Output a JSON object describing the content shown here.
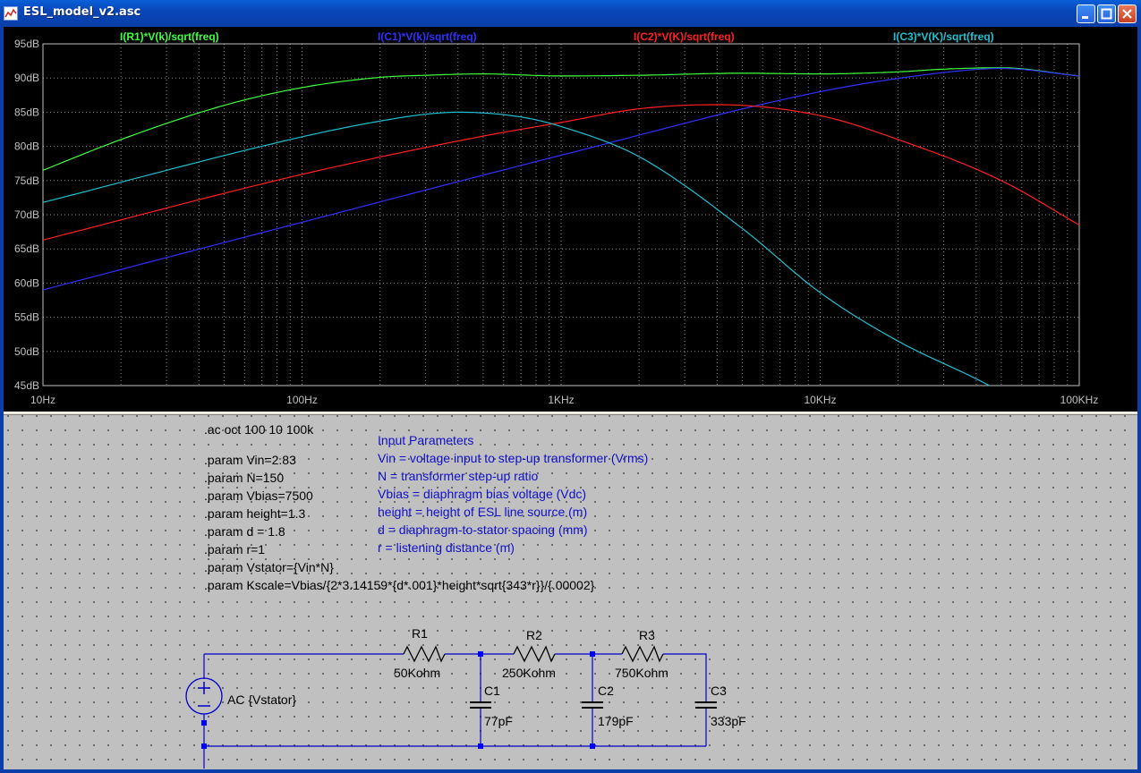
{
  "window": {
    "title": "ESL_model_v2.asc"
  },
  "chart_data": {
    "type": "line",
    "xscale": "log",
    "xlim": [
      10,
      100000
    ],
    "ylim": [
      45,
      95
    ],
    "grid": true,
    "xticks": [
      "10Hz",
      "100Hz",
      "1KHz",
      "10KHz",
      "100KHz"
    ],
    "yticks": [
      "95dB",
      "90dB",
      "85dB",
      "80dB",
      "75dB",
      "70dB",
      "65dB",
      "60dB",
      "55dB",
      "50dB",
      "45dB"
    ],
    "series": [
      {
        "name": "I(R1)*V(k)/sqrt(freq)",
        "color": "#40ff40",
        "x": [
          10,
          20,
          50,
          100,
          200,
          300,
          500,
          1000,
          2000,
          5000,
          10000,
          20000,
          30000,
          50000,
          100000
        ],
        "y": [
          76.5,
          81,
          86,
          88.6,
          90.1,
          90.4,
          90.6,
          90.3,
          90.4,
          90.7,
          90.6,
          90.9,
          91.3,
          91.5,
          90.3
        ]
      },
      {
        "name": "I(C1)*V(k)/sqrt(freq)",
        "color": "#3030ff",
        "x": [
          10,
          100,
          1000,
          10000,
          30000,
          50000,
          100000
        ],
        "y": [
          59,
          68.9,
          78.7,
          88,
          90.8,
          91.4,
          90.3
        ]
      },
      {
        "name": "I(C2)*V(K)/sqrt(freq)",
        "color": "#ff2020",
        "x": [
          10,
          100,
          500,
          1000,
          2000,
          4000,
          10000,
          20000,
          50000,
          100000
        ],
        "y": [
          66.3,
          75.9,
          81.5,
          83.5,
          85.5,
          86.1,
          84.5,
          81,
          75,
          68.5
        ]
      },
      {
        "name": "I(C3)*V(K)/sqrt(freq)",
        "color": "#20c0d0",
        "x": [
          10,
          100,
          200,
          300,
          400,
          700,
          1000,
          2000,
          5000,
          10000,
          20000,
          40000,
          45000
        ],
        "y": [
          71.8,
          81.4,
          83.7,
          84.7,
          85,
          84.3,
          82.9,
          78.5,
          68,
          58.6,
          51.5,
          46,
          45
        ]
      }
    ]
  },
  "schematic": {
    "directives": [
      ".ac oct 100 10 100k",
      ".param Vin=2.83",
      ".param N=150",
      ".param Vbias=7500",
      ".param height=1.3",
      ".param d = 1.8",
      ".param r=1",
      ".param Vstator={Vin*N}",
      ".param Kscale=Vbias/{2*3.14159*{d*.001}*height*sqrt{343*r}}/{.00002}"
    ],
    "comments": [
      "Input Parameters",
      "Vin = voltage input to step-up transformer (Vrms)",
      "N = transformer step-up ratio",
      "Vbias = diaphragm bias voltage (Vdc)",
      "height = height of ESL line source (m)",
      "d = diaphragm-to-stator spacing (mm)",
      "r = listening distance (m)"
    ],
    "components": {
      "r1_name": "R1",
      "r1_value": "50Kohm",
      "r2_name": "R2",
      "r2_value": "250Kohm",
      "r3_name": "R3",
      "r3_value": "750Kohm",
      "c1_name": "C1",
      "c1_value": "77pF",
      "c2_name": "C2",
      "c2_value": "179pF",
      "c3_name": "C3",
      "c3_value": "333pF",
      "source_value": "AC {Vstator}"
    }
  }
}
